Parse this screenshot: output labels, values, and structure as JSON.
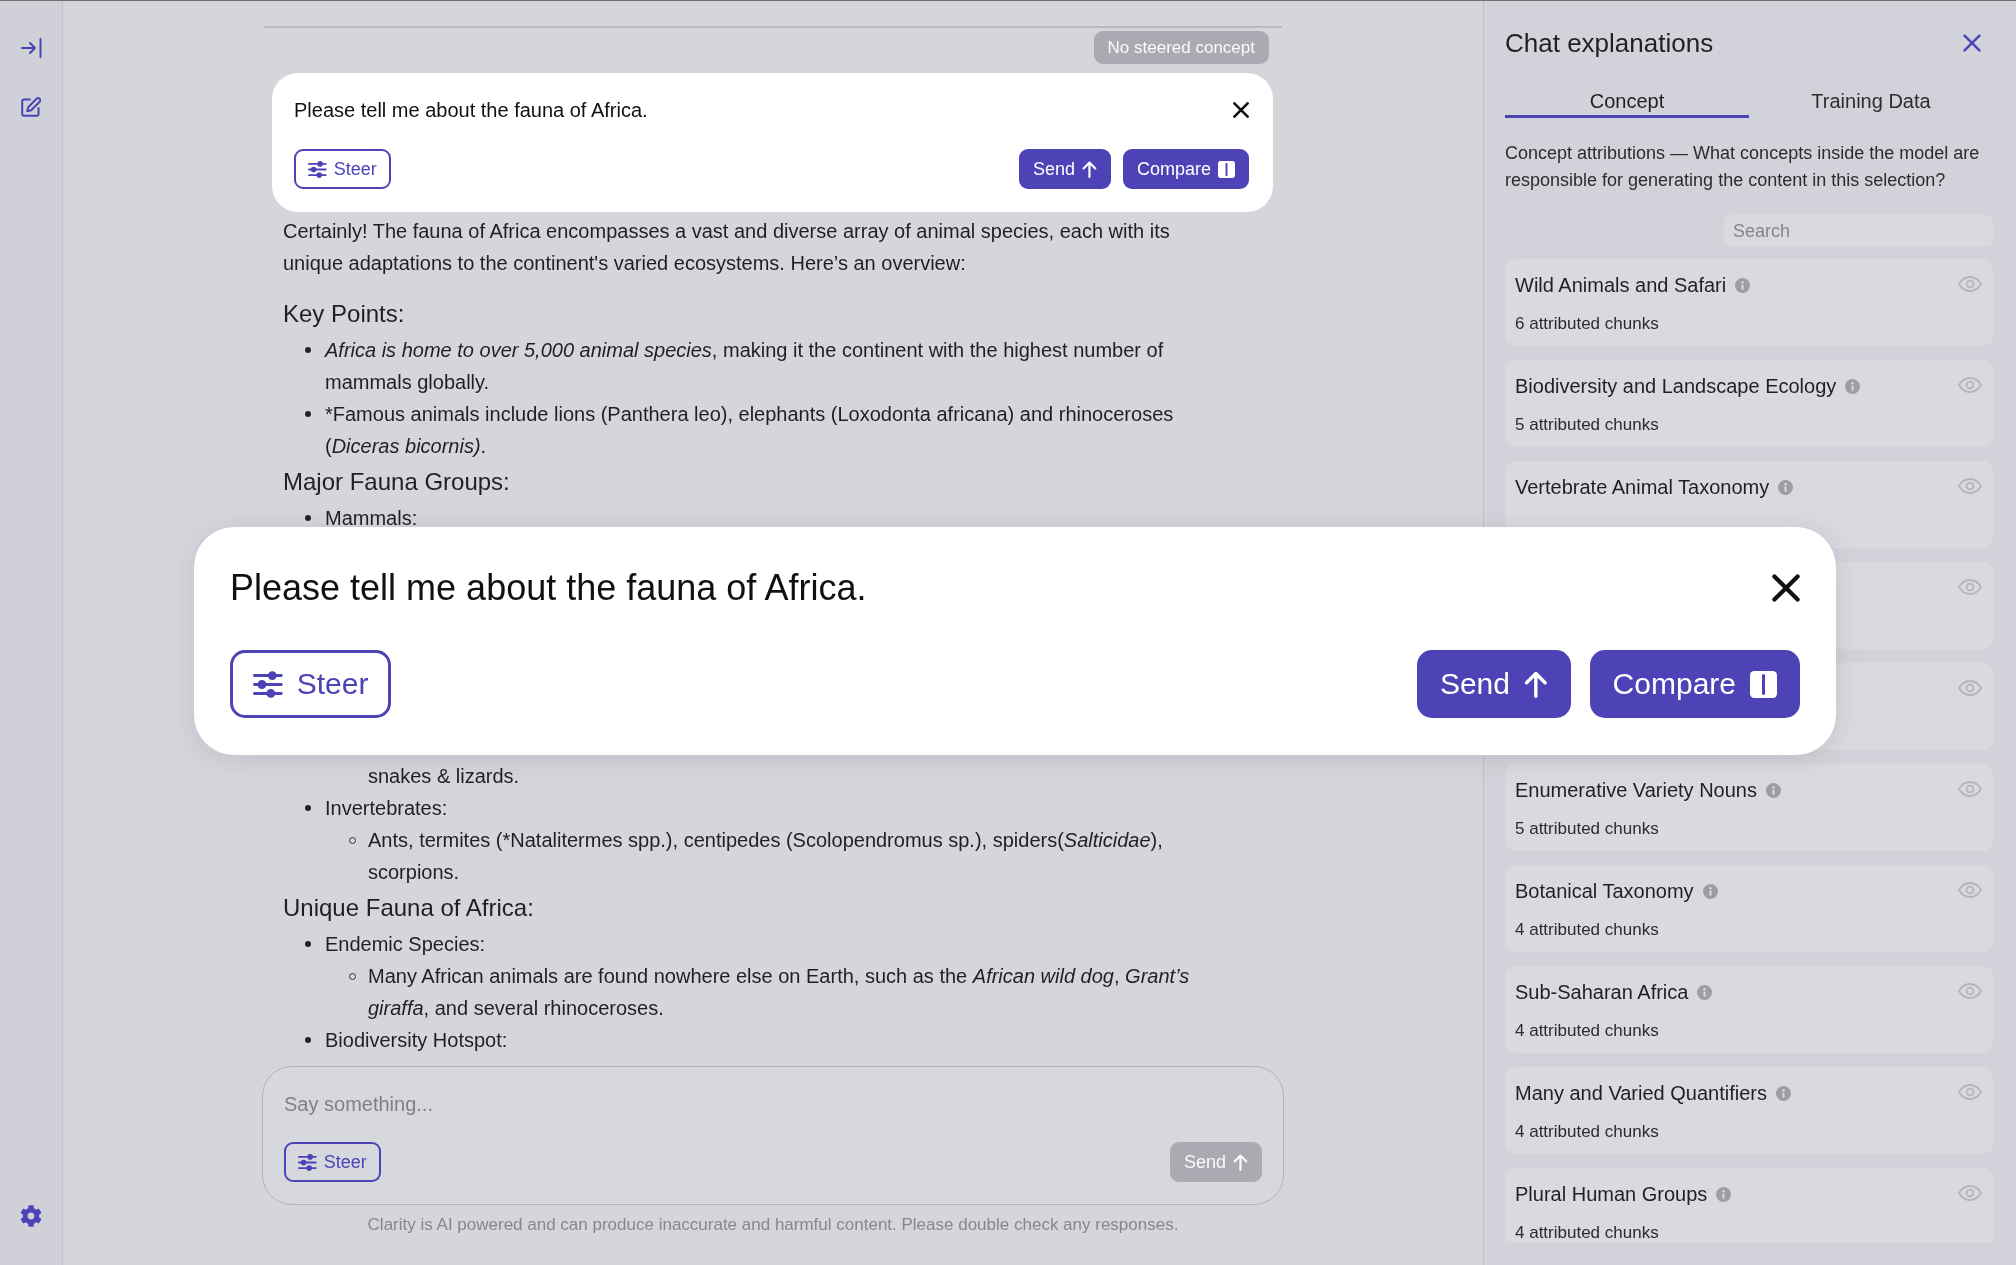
{
  "chat": {
    "steer_status": "No steered concept",
    "prompt": {
      "text": "Please tell me about the fauna of Africa.",
      "buttons": [
        {
          "label": "Steer",
          "kind": "steer",
          "disabled": false
        },
        {
          "label": "Send",
          "kind": "send",
          "disabled": false
        },
        {
          "label": "Compare",
          "kind": "compare",
          "disabled": false
        }
      ]
    },
    "response": {
      "intro": "Certainly! The fauna of Africa encompasses a vast and diverse array of animal species, each with its unique adaptations to the continent's varied ecosystems. Here’s an overview:",
      "sections": [
        {
          "heading": "Key Points:",
          "items": [
            {
              "parts": [
                {
                  "text": "Africa is home to over 5,000 animal species",
                  "italic": true
                },
                {
                  "text": ", making it the continent with the highest number of mammals globally."
                }
              ]
            },
            {
              "parts": [
                {
                  "text": "*Famous animals include lions (Panthera leo), elephants (Loxodonta africana) and rhinoceroses ("
                },
                {
                  "text": "Diceras bicornis)",
                  "italic": true
                },
                {
                  "text": "."
                }
              ]
            }
          ]
        },
        {
          "heading": "Major Fauna Groups:",
          "items": [
            {
              "text": "Mammals:",
              "children": [
                {
                  "kind": "covered"
                },
                {
                  "kind": "continuation",
                  "text": "snakes & lizards."
                }
              ]
            },
            {
              "text": "Invertebrates:",
              "children": [
                {
                  "kind": "bullet",
                  "parts": [
                    {
                      "text": "Ants, termites (*Natalitermes spp.), centipedes (Scolopendromus sp.), spiders("
                    },
                    {
                      "text": "Salticidae",
                      "italic": true
                    },
                    {
                      "text": "), scorpions."
                    }
                  ]
                }
              ]
            }
          ]
        },
        {
          "heading": "Unique Fauna of Africa:",
          "items": [
            {
              "text": "Endemic Species:",
              "children": [
                {
                  "kind": "bullet",
                  "parts": [
                    {
                      "text": "Many African animals are found nowhere else on Earth, such as the "
                    },
                    {
                      "text": "African wild dog",
                      "italic": true
                    },
                    {
                      "text": ", "
                    },
                    {
                      "text": "Grant’s giraffa",
                      "italic": true
                    },
                    {
                      "text": ", and several rhinoceroses."
                    }
                  ]
                }
              ]
            },
            {
              "text": "Biodiversity Hotspot:"
            }
          ]
        }
      ]
    },
    "composer": {
      "placeholder": "Say something...",
      "buttons": [
        {
          "label": "Steer",
          "kind": "steer",
          "disabled": false
        },
        {
          "label": "Send",
          "kind": "send",
          "disabled": true
        }
      ]
    },
    "disclaimer": "Clarity is AI powered and can produce inaccurate and harmful content. Please double check any responses."
  },
  "explanations": {
    "title": "Chat explanations",
    "tabs": [
      {
        "label": "Concept",
        "selected": true
      },
      {
        "label": "Training Data",
        "selected": false
      }
    ],
    "description": "Concept attributions — What concepts inside the model are responsible for generating the content in this selection?",
    "search": {
      "placeholder": "Search"
    },
    "concepts": [
      {
        "kind": "concept",
        "title": "Wild Animals and Safari",
        "count": "6 attributed chunks"
      },
      {
        "kind": "concept",
        "title": "Biodiversity and Landscape Ecology",
        "count": "5 attributed chunks"
      },
      {
        "kind": "concept",
        "title": "Vertebrate Animal Taxonomy"
      },
      {
        "kind": "covered"
      },
      {
        "kind": "covered"
      },
      {
        "kind": "concept",
        "title": "Enumerative Variety Nouns",
        "count": "5 attributed chunks"
      },
      {
        "kind": "concept",
        "title": "Botanical Taxonomy",
        "count": "4 attributed chunks"
      },
      {
        "kind": "concept",
        "title": "Sub-Saharan Africa",
        "count": "4 attributed chunks"
      },
      {
        "kind": "concept",
        "title": "Many and Varied Quantifiers",
        "count": "4 attributed chunks"
      },
      {
        "kind": "concept",
        "title": "Plural Human Groups",
        "count": "4 attributed chunks"
      }
    ]
  },
  "prompt_popup": {
    "text": "Please tell me about the fauna of Africa.",
    "buttons": [
      {
        "label": "Steer",
        "kind": "steer",
        "disabled": false
      },
      {
        "label": "Send",
        "kind": "send",
        "disabled": false
      },
      {
        "label": "Compare",
        "kind": "compare",
        "disabled": false
      }
    ]
  }
}
